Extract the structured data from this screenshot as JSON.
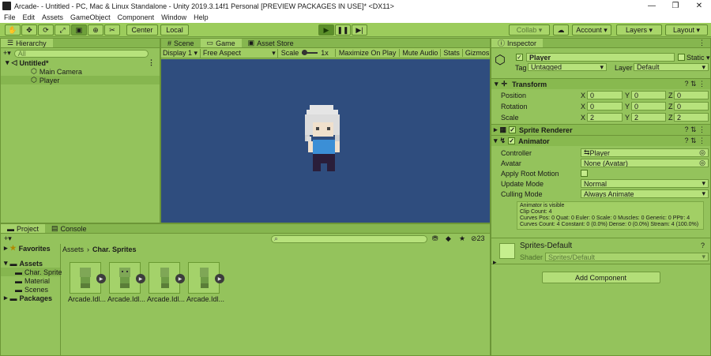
{
  "window": {
    "title": "Arcade- - Untitled - PC, Mac & Linux Standalone - Unity 2019.3.14f1 Personal [PREVIEW PACKAGES IN USE]* <DX11>",
    "min": "—",
    "max": "❐",
    "close": "✕"
  },
  "menu": [
    "File",
    "Edit",
    "Assets",
    "GameObject",
    "Component",
    "Window",
    "Help"
  ],
  "toolbar": {
    "center": "Center",
    "local": "Local",
    "collab": "Collab ▾",
    "account": "Account",
    "layers": "Layers",
    "layout": "Layout"
  },
  "hierarchy": {
    "tab": "Hierarchy",
    "search_placeholder": "All",
    "scene": "Untitled*",
    "items": [
      "Main Camera",
      "Player"
    ]
  },
  "scene_tabs": [
    "Scene",
    "Game",
    "Asset Store"
  ],
  "game": {
    "display": "Display 1",
    "aspect": "Free Aspect",
    "scale_label": "Scale",
    "scale_value": "1x",
    "maximize": "Maximize On Play",
    "mute": "Mute Audio",
    "stats": "Stats",
    "gizmos": "Gizmos"
  },
  "project": {
    "tabs": [
      "Project",
      "Console"
    ],
    "favorites": "Favorites",
    "assets": "Assets",
    "folders": [
      "Char. Sprite",
      "Material",
      "Scenes"
    ],
    "packages": "Packages",
    "breadcrumb": [
      "Assets",
      "Char. Sprites"
    ],
    "count": "23",
    "files": [
      "Arcade.Idl...",
      "Arcade.Idl...",
      "Arcade.Idl...",
      "Arcade.Idl..."
    ]
  },
  "inspector": {
    "tab": "Inspector",
    "object_name": "Player",
    "static": "Static",
    "tag_label": "Tag",
    "tag_value": "Untagged",
    "layer_label": "Layer",
    "layer_value": "Default",
    "transform": {
      "title": "Transform",
      "position": {
        "label": "Position",
        "x": "0",
        "y": "0",
        "z": "0"
      },
      "rotation": {
        "label": "Rotation",
        "x": "0",
        "y": "0",
        "z": "0"
      },
      "scale": {
        "label": "Scale",
        "x": "2",
        "y": "2",
        "z": "2"
      }
    },
    "sprite_renderer": "Sprite Renderer",
    "animator": {
      "title": "Animator",
      "controller_label": "Controller",
      "controller_value": "Player",
      "avatar_label": "Avatar",
      "avatar_value": "None (Avatar)",
      "root_motion_label": "Apply Root Motion",
      "update_label": "Update Mode",
      "update_value": "Normal",
      "culling_label": "Culling Mode",
      "culling_value": "Always Animate",
      "info": [
        "Animator is visible",
        "Clip Count: 4",
        "Curves Pos: 0 Quat: 0 Euler: 0 Scale: 0 Muscles: 0 Generic: 0 PPtr: 4",
        "Curves Count: 4 Constant: 0 (0.0%) Dense: 0 (0.0%) Stream: 4 (100.0%)"
      ]
    },
    "material": {
      "name": "Sprites-Default",
      "shader_label": "Shader",
      "shader_value": "Sprites/Default"
    },
    "add_component": "Add Component"
  },
  "colors": {
    "game_bg": "#2f4d7e",
    "editor_green": "#94c35c"
  }
}
